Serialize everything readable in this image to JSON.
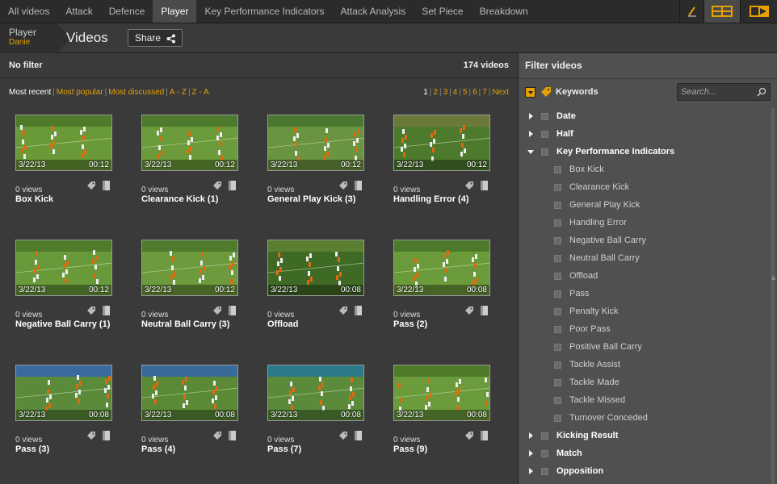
{
  "nav": {
    "tabs": [
      "All videos",
      "Attack",
      "Defence",
      "Player",
      "Key Performance Indicators",
      "Attack Analysis",
      "Set Piece",
      "Breakdown"
    ],
    "active": "Player",
    "icons": [
      "pen-icon",
      "grid-view-icon",
      "play-view-icon"
    ]
  },
  "header": {
    "breadcrumb_parent": "Player",
    "breadcrumb_child": "Danie",
    "title": "Videos",
    "share_label": "Share"
  },
  "main": {
    "filter_text": "No filter",
    "count_text": "174 videos",
    "sort": [
      "Most recent",
      "Most popular",
      "Most discussed",
      "A - Z",
      "Z - A"
    ],
    "sort_active": "Most recent",
    "pages": [
      "1",
      "2",
      "3",
      "4",
      "5",
      "6",
      "7"
    ],
    "next_label": "Next",
    "videos": [
      {
        "date": "3/22/13",
        "duration": "00:12",
        "views": "0 views",
        "title": "Box Kick"
      },
      {
        "date": "3/22/13",
        "duration": "00:12",
        "views": "0 views",
        "title": "Clearance Kick (1)"
      },
      {
        "date": "3/22/13",
        "duration": "00:12",
        "views": "0 views",
        "title": "General Play Kick (3)"
      },
      {
        "date": "3/22/13",
        "duration": "00:12",
        "views": "0 views",
        "title": "Handling Error (4)"
      },
      {
        "date": "3/22/13",
        "duration": "00:12",
        "views": "0 views",
        "title": "Negative Ball Carry (1)"
      },
      {
        "date": "3/22/13",
        "duration": "00:12",
        "views": "0 views",
        "title": "Neutral Ball Carry (3)"
      },
      {
        "date": "3/22/13",
        "duration": "00:08",
        "views": "0 views",
        "title": "Offload"
      },
      {
        "date": "3/22/13",
        "duration": "00:08",
        "views": "0 views",
        "title": "Pass (2)"
      },
      {
        "date": "3/22/13",
        "duration": "00:08",
        "views": "0 views",
        "title": "Pass (3)"
      },
      {
        "date": "3/22/13",
        "duration": "00:08",
        "views": "0 views",
        "title": "Pass (4)"
      },
      {
        "date": "3/22/13",
        "duration": "00:08",
        "views": "0 views",
        "title": "Pass (7)"
      },
      {
        "date": "3/22/13",
        "duration": "00:08",
        "views": "0 views",
        "title": "Pass (9)"
      }
    ]
  },
  "sidebar": {
    "title": "Filter videos",
    "keywords_label": "Keywords",
    "search_placeholder": "Search...",
    "groups_top": [
      "Date",
      "Half"
    ],
    "kpi_group": "Key Performance Indicators",
    "kpi_items": [
      "Box Kick",
      "Clearance Kick",
      "General Play Kick",
      "Handling Error",
      "Negative Ball Carry",
      "Neutral Ball Carry",
      "Offload",
      "Pass",
      "Penalty Kick",
      "Poor Pass",
      "Positive Ball Carry",
      "Tackle Assist",
      "Tackle Made",
      "Tackle Missed",
      "Turnover Conceded"
    ],
    "groups_bottom": [
      "Kicking Result",
      "Match",
      "Opposition"
    ]
  },
  "colors": {
    "accent": "#e8a000",
    "background": "#3a3a3a",
    "sidebar": "#505050"
  }
}
